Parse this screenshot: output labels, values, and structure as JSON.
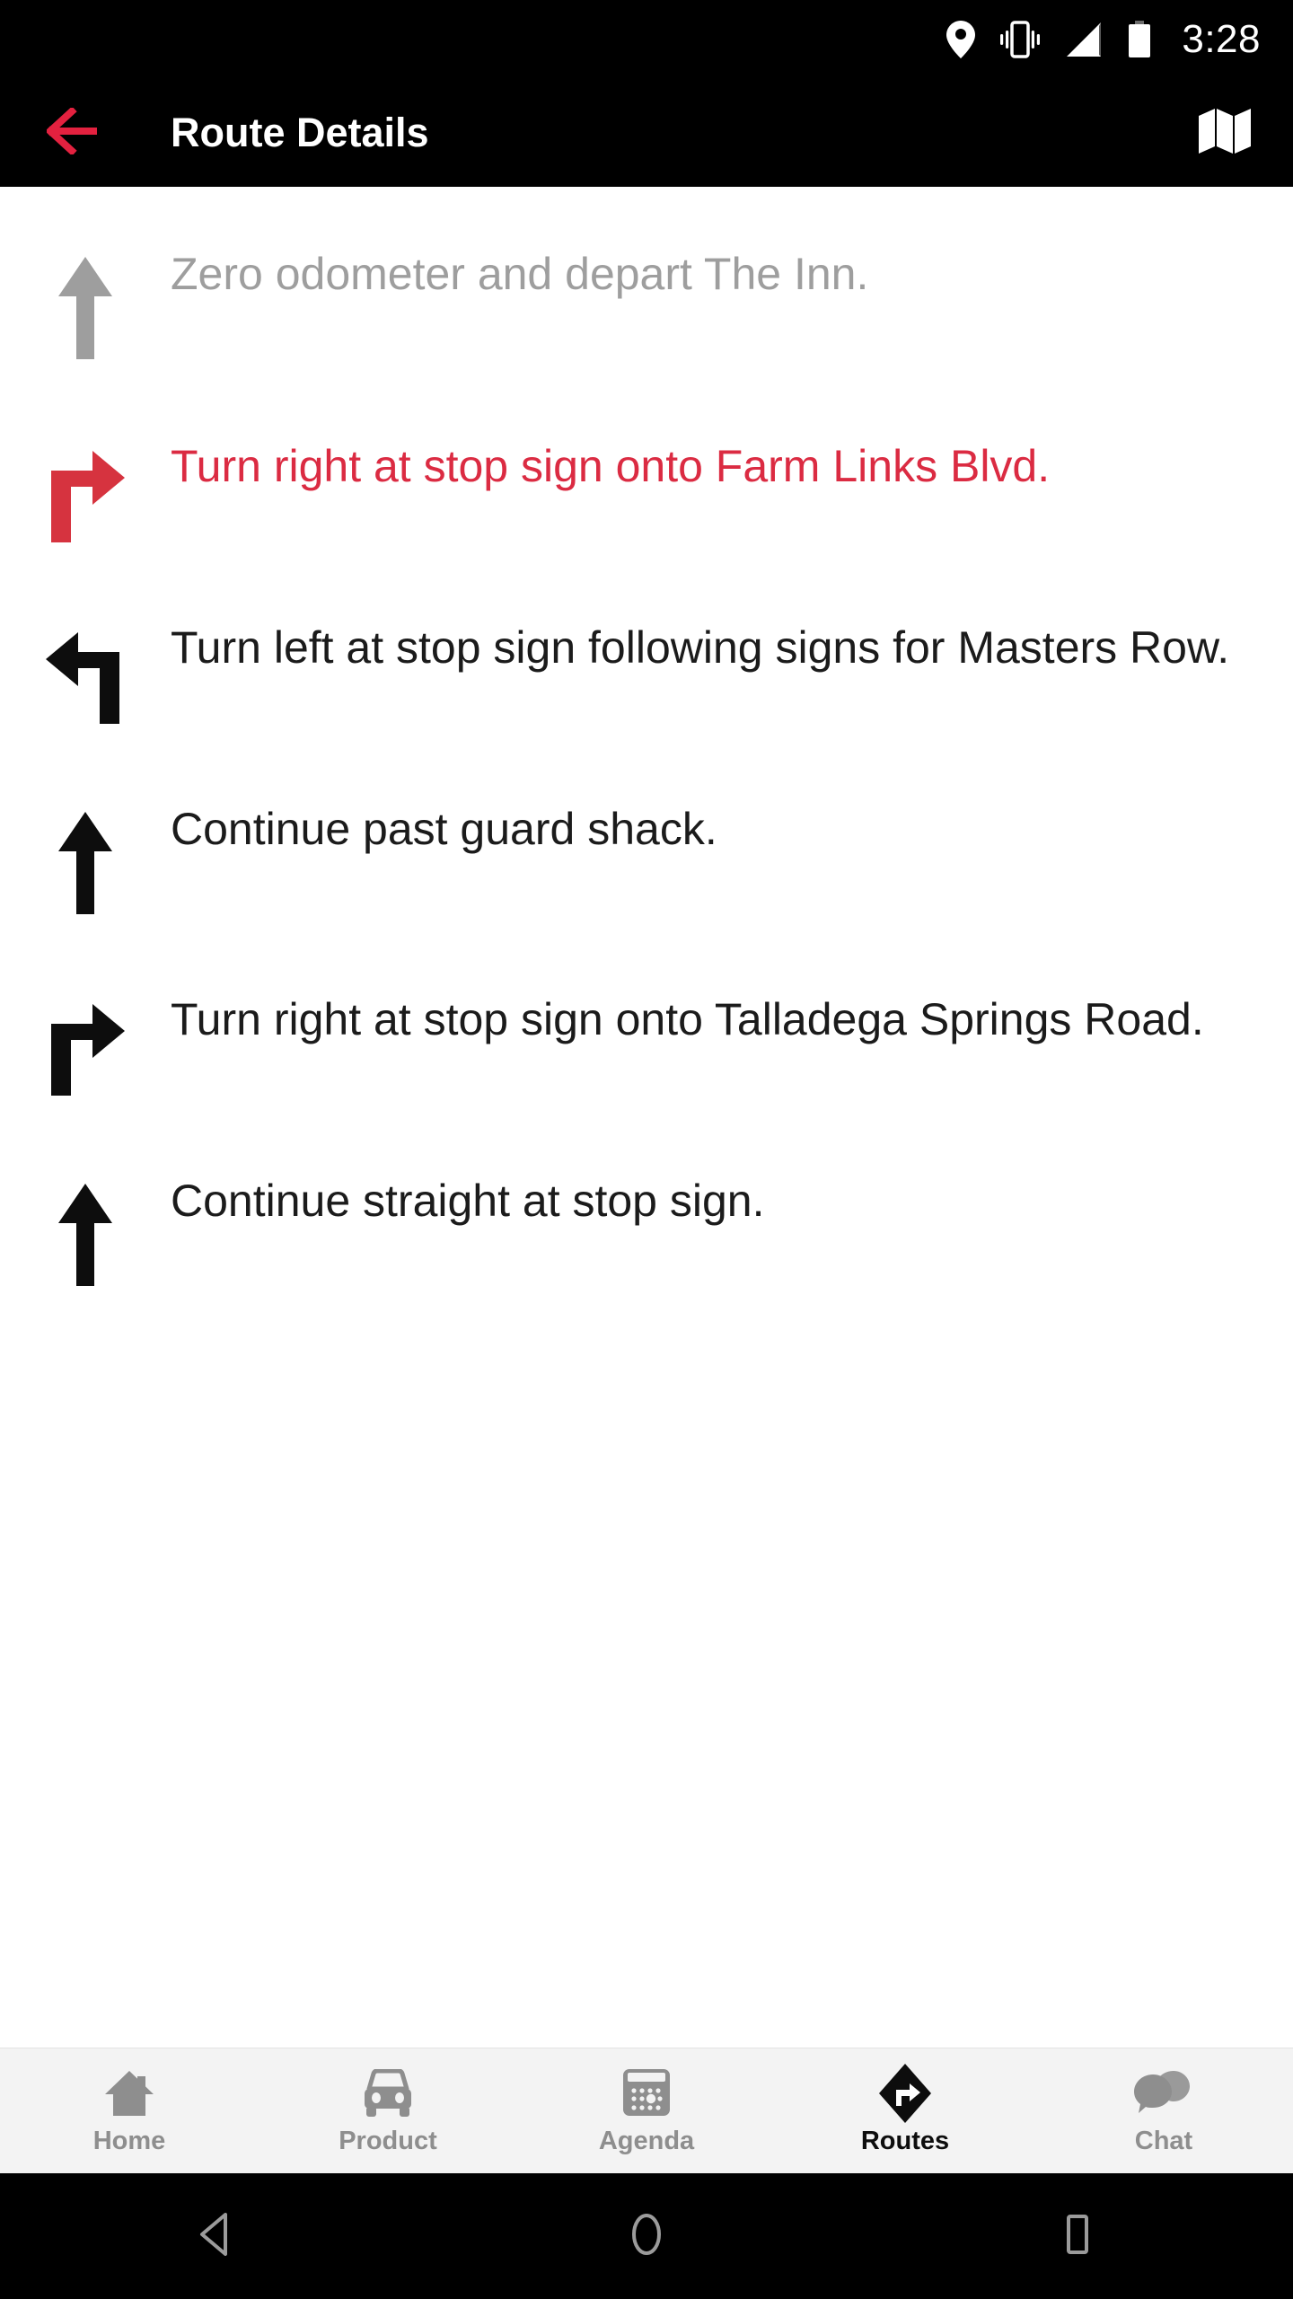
{
  "statusbar": {
    "time": "3:28",
    "icons": [
      "location-pin-icon",
      "vibrate-icon",
      "signal-icon",
      "battery-icon"
    ]
  },
  "appbar": {
    "back_icon": "back-arrow-icon",
    "title": "Route Details",
    "action_icon": "map-icon",
    "back_color": "#e3213f",
    "background": "#000000",
    "title_color": "#ffffff"
  },
  "colors": {
    "accent_red": "#db2b42",
    "muted_gray": "#9e9e9e",
    "text_black": "#1b1b1b",
    "tabbar_bg": "#f3f3f3"
  },
  "route": {
    "steps": [
      {
        "icon": "straight-arrow-icon",
        "text": "Zero odometer and depart The Inn.",
        "state": "muted"
      },
      {
        "icon": "turn-right-arrow-icon",
        "text": "Turn right at stop sign onto Farm Links Blvd.",
        "state": "active"
      },
      {
        "icon": "turn-left-arrow-icon",
        "text": "Turn left at stop sign following signs for Masters Row.",
        "state": "normal"
      },
      {
        "icon": "straight-arrow-icon",
        "text": "Continue past guard shack.",
        "state": "normal"
      },
      {
        "icon": "turn-right-arrow-icon",
        "text": "Turn right at stop sign onto Talladega Springs Road.",
        "state": "normal"
      },
      {
        "icon": "straight-arrow-icon",
        "text": "Continue straight at stop sign.",
        "state": "normal"
      }
    ]
  },
  "tabbar": {
    "items": [
      {
        "label": "Home",
        "icon": "home-icon",
        "active": false
      },
      {
        "label": "Product",
        "icon": "car-icon",
        "active": false
      },
      {
        "label": "Agenda",
        "icon": "calendar-icon",
        "active": false
      },
      {
        "label": "Routes",
        "icon": "directions-icon",
        "active": true
      },
      {
        "label": "Chat",
        "icon": "chat-bubbles-icon",
        "active": false
      }
    ]
  },
  "sysnav": {
    "buttons": [
      {
        "name": "android-back-button",
        "icon": "triangle-left-icon"
      },
      {
        "name": "android-home-button",
        "icon": "circle-icon"
      },
      {
        "name": "android-recents-button",
        "icon": "square-icon"
      }
    ]
  }
}
